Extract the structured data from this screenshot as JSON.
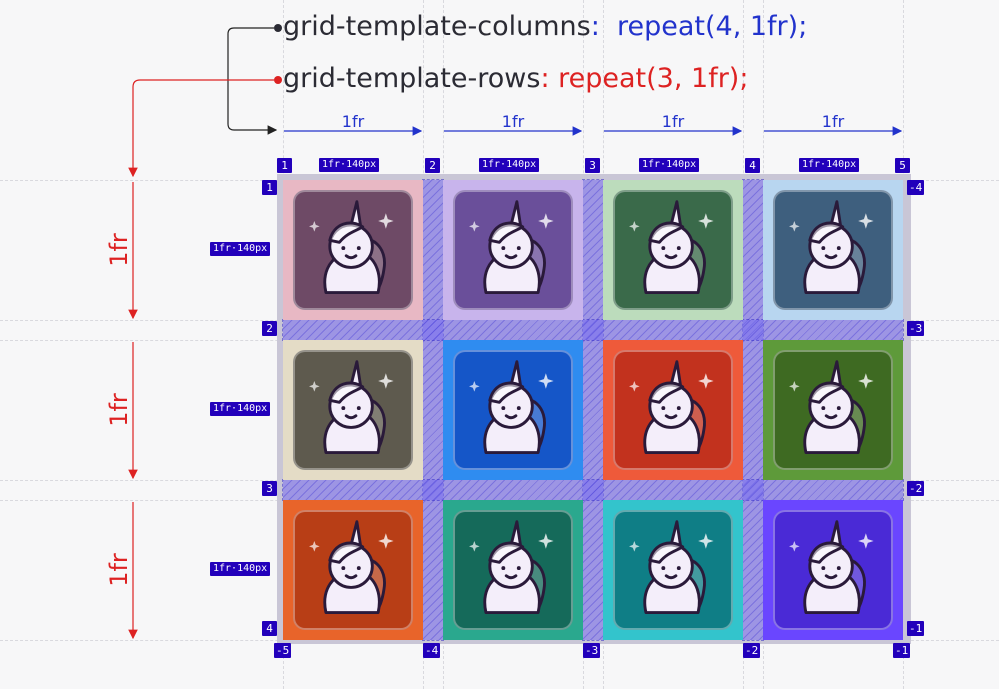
{
  "code": {
    "columns_prop": "grid-template-columns",
    "columns_sep": ":",
    "columns_value": "repeat(4, 1fr);",
    "rows_prop": "grid-template-rows",
    "rows_sep": ":",
    "rows_value": "repeat(3, 1fr);"
  },
  "track_label": "1fr",
  "size_tag": "1fr·140px",
  "column_line_numbers": [
    "1",
    "2",
    "3",
    "4",
    "5"
  ],
  "column_line_negatives": [
    "-5",
    "-4",
    "-3",
    "-2",
    "-1"
  ],
  "row_line_numbers": [
    "1",
    "2",
    "3",
    "4"
  ],
  "row_line_negatives": [
    "-4",
    "-3",
    "-2",
    "-1"
  ],
  "colors": {
    "column_accent": "#2233cc",
    "row_accent": "#dd2222",
    "tag_bg": "#2200bb",
    "gap_fill": "#7e72f0"
  },
  "cells": [
    {
      "icon": "sleeping-unicorn-icon",
      "bg": "#e8b8c4",
      "card": "#6e4a66"
    },
    {
      "icon": "thinking-unicorn-icon",
      "bg": "#c8b4ec",
      "card": "#6a4f9a"
    },
    {
      "icon": "dancing-unicorn-icon",
      "bg": "#bcdcbc",
      "card": "#3a6a4a"
    },
    {
      "icon": "blowing-kiss-unicorn-icon",
      "bg": "#b8d6f0",
      "card": "#3e5f7e"
    },
    {
      "icon": "star-eyed-unicorn-icon",
      "bg": "#e4dcc6",
      "card": "#5e5a4e"
    },
    {
      "icon": "monocle-unicorn-icon",
      "bg": "#2f8cf0",
      "card": "#1556c8"
    },
    {
      "icon": "winking-unicorn-icon",
      "bg": "#ee5a3a",
      "card": "#c2321e"
    },
    {
      "icon": "singing-unicorn-icon",
      "bg": "#5e9a3a",
      "card": "#3e6a22"
    },
    {
      "icon": "rich-unicorn-icon",
      "bg": "#e8642a",
      "card": "#b83e16"
    },
    {
      "icon": "thumbs-up-unicorn-icon",
      "bg": "#2aa88e",
      "card": "#156a5a"
    },
    {
      "icon": "happy-unicorn-icon",
      "bg": "#33c4cc",
      "card": "#0f7e86"
    },
    {
      "icon": "starry-unicorn-icon",
      "bg": "#6a46ff",
      "card": "#4a2ad6"
    }
  ]
}
